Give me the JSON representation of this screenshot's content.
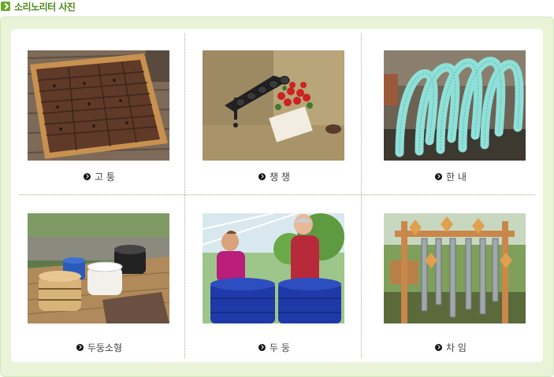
{
  "section": {
    "title": "소리노리터 사진"
  },
  "photos": [
    {
      "caption": "고 퉁",
      "icon": "wooden-xylophone-photo"
    },
    {
      "caption": "챙 챙",
      "icon": "wall-chimes-photo"
    },
    {
      "caption": "한 내",
      "icon": "blue-tube-instrument-photo"
    },
    {
      "caption": "두둥소형",
      "icon": "small-drums-photo"
    },
    {
      "caption": "두 둥",
      "icon": "blue-barrel-drums-photo"
    },
    {
      "caption": "차 임",
      "icon": "wind-chimes-photo"
    }
  ]
}
